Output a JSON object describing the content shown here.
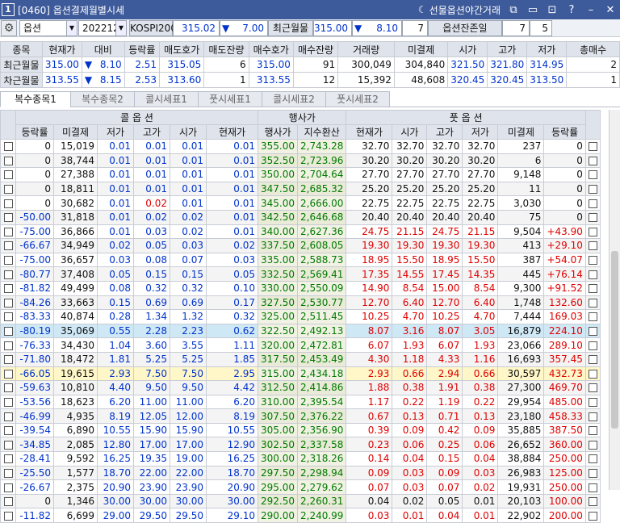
{
  "window": {
    "number": "1",
    "title": "[0460] 옵션결제월별시세",
    "night_label": "선물옵션야간거래"
  },
  "icons": [
    "moon-icon",
    "restore-icon",
    "window-icon",
    "dock-icon",
    "help-icon",
    "minimize-icon",
    "close-icon"
  ],
  "ctrl": {
    "type": "옵션",
    "month": "202212",
    "index_name": "KOSPI200",
    "index_value": "315.02",
    "index_arrow": "▼",
    "index_change": "7.00",
    "atm_label": "최근월물",
    "atm_value": "315.00",
    "atm_arrow": "▼",
    "atm_change": "8.10",
    "atm_count": "7",
    "remain_label": "옵션잔존일",
    "remain_a": "7",
    "remain_b": "5"
  },
  "summary": {
    "headers": [
      "종목",
      "현재가",
      "대비",
      "등락률",
      "매도호가",
      "매도잔량",
      "매수호가",
      "매수잔량",
      "거래량",
      "미결제",
      "시가",
      "고가",
      "저가",
      "총매수"
    ],
    "rows": [
      {
        "name": "최근월물",
        "price": "315.00",
        "arrow": "▼",
        "change": "8.10",
        "rate": "2.51",
        "ask": "315.05",
        "askq": "6",
        "bid": "315.00",
        "bidq": "91",
        "vol": "300,049",
        "oi": "304,840",
        "open": "321.50",
        "high": "321.80",
        "low": "314.95",
        "tot": "2"
      },
      {
        "name": "차근월물",
        "price": "313.55",
        "arrow": "▼",
        "change": "8.15",
        "rate": "2.53",
        "ask": "313.60",
        "askq": "1",
        "bid": "313.55",
        "bidq": "12",
        "vol": "15,392",
        "oi": "48,608",
        "open": "320.45",
        "high": "320.45",
        "low": "313.50",
        "tot": "1"
      }
    ]
  },
  "tabs": [
    "복수종목1",
    "복수종목2",
    "콜시세표1",
    "풋시세표1",
    "콜시세표2",
    "풋시세표2"
  ],
  "grid": {
    "group_call": "콜 옵 션",
    "group_strike": "행사가",
    "group_put": "풋 옵 션",
    "headers": [
      "등락률",
      "미결제",
      "저가",
      "고가",
      "시가",
      "현재가",
      "행사가",
      "지수환산",
      "현재가",
      "시가",
      "고가",
      "저가",
      "미결제",
      "등락률"
    ],
    "rows": [
      [
        "0",
        "15,019",
        "0.01",
        "0.01",
        "0.01",
        "0.01",
        "355.00",
        "2,743.28",
        "32.70",
        "32.70",
        "32.70",
        "32.70",
        "237",
        "0"
      ],
      [
        "0",
        "38,744",
        "0.01",
        "0.01",
        "0.01",
        "0.01",
        "352.50",
        "2,723.96",
        "30.20",
        "30.20",
        "30.20",
        "30.20",
        "6",
        "0"
      ],
      [
        "0",
        "27,388",
        "0.01",
        "0.01",
        "0.01",
        "0.01",
        "350.00",
        "2,704.64",
        "27.70",
        "27.70",
        "27.70",
        "27.70",
        "9,148",
        "0"
      ],
      [
        "0",
        "18,811",
        "0.01",
        "0.01",
        "0.01",
        "0.01",
        "347.50",
        "2,685.32",
        "25.20",
        "25.20",
        "25.20",
        "25.20",
        "11",
        "0"
      ],
      [
        "0",
        "30,682",
        "0.01",
        "0.02",
        "0.01",
        "0.01",
        "345.00",
        "2,666.00",
        "22.75",
        "22.75",
        "22.75",
        "22.75",
        "3,030",
        "0"
      ],
      [
        "-50.00",
        "31,818",
        "0.01",
        "0.02",
        "0.02",
        "0.01",
        "342.50",
        "2,646.68",
        "20.40",
        "20.40",
        "20.40",
        "20.40",
        "75",
        "0"
      ],
      [
        "-75.00",
        "36,866",
        "0.01",
        "0.03",
        "0.02",
        "0.01",
        "340.00",
        "2,627.36",
        "24.75",
        "21.15",
        "24.75",
        "21.15",
        "9,504",
        "+43.90"
      ],
      [
        "-66.67",
        "34,949",
        "0.02",
        "0.05",
        "0.03",
        "0.02",
        "337.50",
        "2,608.05",
        "19.30",
        "19.30",
        "19.30",
        "19.30",
        "413",
        "+29.10"
      ],
      [
        "-75.00",
        "36,657",
        "0.03",
        "0.08",
        "0.07",
        "0.03",
        "335.00",
        "2,588.73",
        "18.95",
        "15.50",
        "18.95",
        "15.50",
        "387",
        "+54.07"
      ],
      [
        "-80.77",
        "37,408",
        "0.05",
        "0.15",
        "0.15",
        "0.05",
        "332.50",
        "2,569.41",
        "17.35",
        "14.55",
        "17.45",
        "14.35",
        "445",
        "+76.14"
      ],
      [
        "-81.82",
        "49,499",
        "0.08",
        "0.32",
        "0.32",
        "0.10",
        "330.00",
        "2,550.09",
        "14.90",
        "8.54",
        "15.00",
        "8.54",
        "9,300",
        "+91.52"
      ],
      [
        "-84.26",
        "33,663",
        "0.15",
        "0.69",
        "0.69",
        "0.17",
        "327.50",
        "2,530.77",
        "12.70",
        "6.40",
        "12.70",
        "6.40",
        "1,748",
        "132.60"
      ],
      [
        "-83.33",
        "40,874",
        "0.28",
        "1.34",
        "1.32",
        "0.32",
        "325.00",
        "2,511.45",
        "10.25",
        "4.70",
        "10.25",
        "4.70",
        "7,444",
        "169.03"
      ],
      [
        "-80.19",
        "35,069",
        "0.55",
        "2.28",
        "2.23",
        "0.62",
        "322.50",
        "2,492.13",
        "8.07",
        "3.16",
        "8.07",
        "3.05",
        "16,879",
        "224.10"
      ],
      [
        "-76.33",
        "34,430",
        "1.04",
        "3.60",
        "3.55",
        "1.11",
        "320.00",
        "2,472.81",
        "6.07",
        "1.93",
        "6.07",
        "1.93",
        "23,066",
        "289.10"
      ],
      [
        "-71.80",
        "18,472",
        "1.81",
        "5.25",
        "5.25",
        "1.85",
        "317.50",
        "2,453.49",
        "4.30",
        "1.18",
        "4.33",
        "1.16",
        "16,693",
        "357.45"
      ],
      [
        "-66.05",
        "19,615",
        "2.93",
        "7.50",
        "7.50",
        "2.95",
        "315.00",
        "2,434.18",
        "2.93",
        "0.66",
        "2.94",
        "0.66",
        "30,597",
        "432.73"
      ],
      [
        "-59.63",
        "10,810",
        "4.40",
        "9.50",
        "9.50",
        "4.42",
        "312.50",
        "2,414.86",
        "1.88",
        "0.38",
        "1.91",
        "0.38",
        "27,300",
        "469.70"
      ],
      [
        "-53.56",
        "18,623",
        "6.20",
        "11.00",
        "11.00",
        "6.20",
        "310.00",
        "2,395.54",
        "1.17",
        "0.22",
        "1.19",
        "0.22",
        "29,954",
        "485.00"
      ],
      [
        "-46.99",
        "4,935",
        "8.19",
        "12.05",
        "12.00",
        "8.19",
        "307.50",
        "2,376.22",
        "0.67",
        "0.13",
        "0.71",
        "0.13",
        "23,180",
        "458.33"
      ],
      [
        "-39.54",
        "6,890",
        "10.55",
        "15.90",
        "15.90",
        "10.55",
        "305.00",
        "2,356.90",
        "0.39",
        "0.09",
        "0.42",
        "0.09",
        "35,885",
        "387.50"
      ],
      [
        "-34.85",
        "2,085",
        "12.80",
        "17.00",
        "17.00",
        "12.90",
        "302.50",
        "2,337.58",
        "0.23",
        "0.06",
        "0.25",
        "0.06",
        "26,652",
        "360.00"
      ],
      [
        "-28.41",
        "9,592",
        "16.25",
        "19.35",
        "19.00",
        "16.25",
        "300.00",
        "2,318.26",
        "0.14",
        "0.04",
        "0.15",
        "0.04",
        "38,884",
        "250.00"
      ],
      [
        "-25.50",
        "1,577",
        "18.70",
        "22.00",
        "22.00",
        "18.70",
        "297.50",
        "2,298.94",
        "0.09",
        "0.03",
        "0.09",
        "0.03",
        "26,983",
        "125.00"
      ],
      [
        "-26.67",
        "2,375",
        "20.90",
        "23.90",
        "23.90",
        "20.90",
        "295.00",
        "2,279.62",
        "0.07",
        "0.03",
        "0.07",
        "0.02",
        "19,931",
        "250.00"
      ],
      [
        "0",
        "1,346",
        "30.00",
        "30.00",
        "30.00",
        "30.00",
        "292.50",
        "2,260.31",
        "0.04",
        "0.02",
        "0.05",
        "0.01",
        "20,103",
        "100.00"
      ],
      [
        "-11.82",
        "6,699",
        "29.00",
        "29.50",
        "29.50",
        "29.10",
        "290.00",
        "2,240.99",
        "0.03",
        "0.01",
        "0.04",
        "0.01",
        "22,902",
        "200.00"
      ]
    ]
  }
}
